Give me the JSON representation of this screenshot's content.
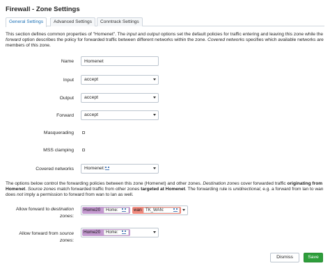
{
  "dialog": {
    "title": "Firewall - Zone Settings",
    "tabs": [
      "General Settings",
      "Advanced Settings",
      "Conntrack Settings"
    ]
  },
  "intro": {
    "t1": "This section defines common properties of \"Homenet\". The ",
    "t2": "input",
    "t3": " and ",
    "t4": "output",
    "t5": " options set the default policies for traffic entering and leaving this zone while the ",
    "t6": "forward",
    "t7": " option describes the policy for forwarded traffic between different networks within the zone. ",
    "t8": "Covered networks",
    "t9": " specifies which available networks are members of this zone."
  },
  "fields": {
    "name_label": "Name",
    "name_value": "Homenet",
    "input_label": "Input",
    "input_value": "accept",
    "output_label": "Output",
    "output_value": "accept",
    "forward_label": "Forward",
    "forward_value": "accept",
    "masq_label": "Masquerading",
    "mss_label": "MSS clamping",
    "covered_label": "Covered networks",
    "covered_value": "Homenet:"
  },
  "forwarding": {
    "t1": "The options below control the forwarding policies between this zone (Homenet) and other zones. ",
    "t2": "Destination zones",
    "t3": " cover forwarded traffic ",
    "t4": "originating from Homenet",
    "t5": ". ",
    "t6": "Source zones",
    "t7": " match forwarded traffic from other zones ",
    "t8": "targeted at Homenet",
    "t9": ". The forwarding rule is ",
    "t10": "unidirectional",
    "t11": ", e.g. a forward from lan to wan does ",
    "t12": "not",
    "t13": " imply a permission to forward from wan to lan as well.",
    "dest_label_a": "Allow forward to ",
    "dest_label_b": "destination",
    "dest_label_c": "zones",
    "src_label_a": "Allow forward from ",
    "src_label_b": "source",
    "src_label_c": "zones",
    "colon": ":",
    "zone_home": "Home20",
    "zone_home_net": "Home:",
    "zone_wan": "wan",
    "zone_wan_net": "TK_WAN:"
  },
  "colors": {
    "home_zone": "#c49ad0",
    "wan_zone": "#f08a7e",
    "save": "#2e9e3b",
    "tab_active_text": "#1a6fb5"
  },
  "buttons": {
    "dismiss": "Dismiss",
    "save": "Save"
  }
}
